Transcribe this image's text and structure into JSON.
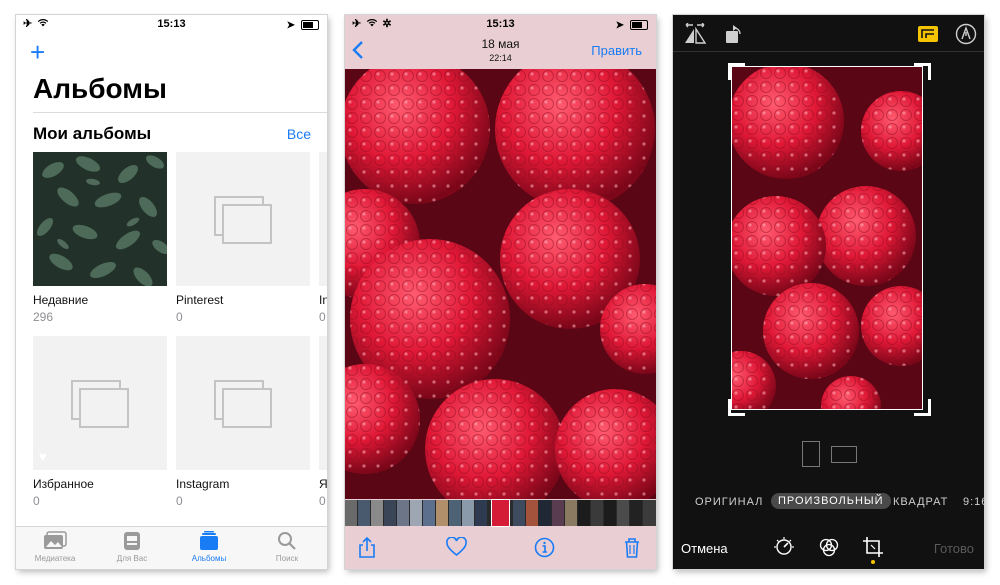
{
  "status": {
    "time": "15:13"
  },
  "albums_screen": {
    "title": "Альбомы",
    "section_title": "Мои альбомы",
    "see_all": "Все",
    "albums": [
      {
        "name": "Недавние",
        "count": "296"
      },
      {
        "name": "Pinterest",
        "count": "0"
      },
      {
        "name": "In",
        "count": "0"
      },
      {
        "name": "Избранное",
        "count": "0"
      },
      {
        "name": "Instagram",
        "count": "0"
      },
      {
        "name": "Я",
        "count": "0"
      }
    ],
    "tabs": [
      {
        "label": "Медиатека",
        "icon": "photo-library-icon"
      },
      {
        "label": "Для Вас",
        "icon": "for-you-icon"
      },
      {
        "label": "Альбомы",
        "icon": "albums-icon"
      },
      {
        "label": "Поиск",
        "icon": "search-icon"
      }
    ],
    "active_tab": "Альбомы",
    "accent": "#1a7cf5"
  },
  "photo_screen": {
    "date": "18 мая",
    "time": "22:14",
    "edit_label": "Править",
    "toolbar_icons": [
      "share-icon",
      "heart-icon",
      "info-icon",
      "trash-icon"
    ]
  },
  "edit_screen": {
    "ratios": [
      "ОРИГИНАЛ",
      "ПРОИЗВОЛЬНЫЙ",
      "КВАДРАТ",
      "9:16"
    ],
    "selected_ratio": "ПРОИЗВОЛЬНЫЙ",
    "cancel_label": "Отмена",
    "done_label": "Готово",
    "top_icons": [
      "flip-icon",
      "rotate-icon",
      "aspect-ratio-icon",
      "markup-icon"
    ],
    "bottom_icons": [
      "adjust-icon",
      "filters-icon",
      "crop-icon"
    ],
    "accent": "#f5c400"
  }
}
